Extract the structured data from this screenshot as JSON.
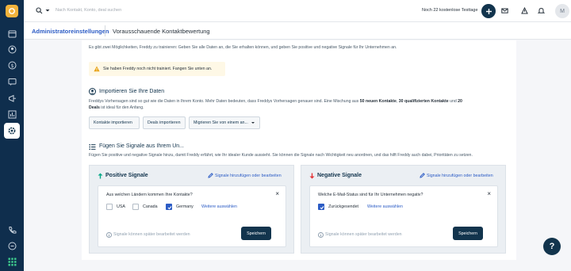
{
  "search": {
    "placeholder": "Nach Kontakt, Konto, deal suchen"
  },
  "topbar": {
    "trial_text": "Noch 22 kostenlose Testtage",
    "avatar_initial": "M"
  },
  "breadcrumb": {
    "parent": "Administratoreinstellungen",
    "current": "Vorausschauende Kontaktbewertung"
  },
  "intro_text": "Es gibt zwei Möglichkeiten, Freddy zu trainieren: Geben Sie alle Daten an, die Sie erhalten können, und geben Sie positive und negative Signale für Ihr Unternehmen an.",
  "warning": {
    "text": "Sie haben Freddy noch nicht trainiert. Fangen Sie unten an."
  },
  "import": {
    "title": "Importieren Sie Ihre Daten",
    "text_a": "Freddys Vorhersagen sind so gut wie die Daten in Ihrem Konto. Mehr Daten bedeuten, dass Freddys Vorhersagen genauer sind. Eine Mischung aus",
    "bold_1": "50 neuen Kontakte",
    "sep_1": ",",
    "bold_2": "30 qualifizierten Kontakte",
    "text_b": "und",
    "bold_3": "20",
    "bold_4": "Deals",
    "text_c": "ist ideal für den Anfang.",
    "buttons": {
      "contacts": "Kontakte importieren",
      "deals": "Deals importieren",
      "migrate": "Migrieren Sie von einem an..."
    }
  },
  "signals": {
    "title": "Fügen Sie Signale aus Ihrem Un...",
    "text": "Fügen Sie positive und negative Signale hinzu, damit Freddy erfährt, wie Ihr idealer Kunde aussieht. Sie können die Signale nach Wichtigkeit neu anordnen, und das hilft Freddy auch dabei, Prioritäten zu setzen."
  },
  "positive": {
    "title": "Positive Signale",
    "link": "Signale hinzufügen oder bearbeiten",
    "question": "Aus welchen Ländern kommen Ihre Kontakte?",
    "options": [
      {
        "label": "USA",
        "checked": false
      },
      {
        "label": "Canada",
        "checked": false
      },
      {
        "label": "Germany",
        "checked": true
      }
    ],
    "more": "Weitere auswählen",
    "hint": "Signale können später bearbeitet werden",
    "save": "Speichern",
    "close": "×",
    "accent": "#00a886"
  },
  "negative": {
    "title": "Negative Signale",
    "link": "Signale hinzufügen oder bearbeiten",
    "question": "Welche E-Mail-Status sind für Ihr Unternehmen negativ?",
    "options": [
      {
        "label": "Zurückgesendet",
        "checked": true
      }
    ],
    "more": "Weitere auswählen",
    "hint": "Signale können später bearbeitet werden",
    "save": "Speichern",
    "close": "×",
    "accent": "#e43538"
  },
  "help": {
    "label": "?"
  }
}
